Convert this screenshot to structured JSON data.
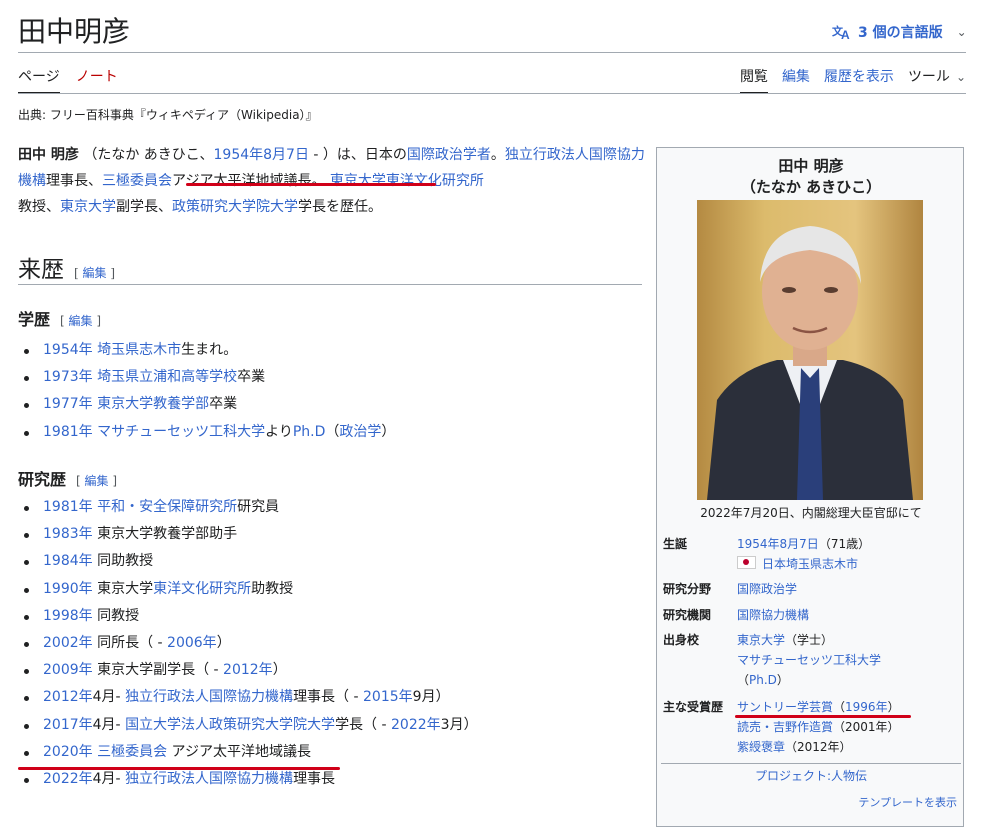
{
  "header": {
    "title": "田中明彦",
    "lang_icon": "translate-icon",
    "lang_label": "3 個の言語版",
    "tabs_left": {
      "page": "ページ",
      "note": "ノート"
    },
    "tabs_right": {
      "read": "閲覧",
      "edit": "編集",
      "history": "履歴を表示",
      "tools": "ツール"
    }
  },
  "source": "出典: フリー百科事典『ウィキペディア（Wikipedia）』",
  "intro": {
    "name": "田中 明彦",
    "reading_open": "（たなか あきひこ、",
    "birth": "1954年8月7日",
    "reading_close": " - ）は、日本の",
    "field": "国際政治学者",
    "t1": "。",
    "jica": "独立行政法人国際協力機構",
    "t2": "理事長、",
    "trilateral": "三極委員会",
    "t3": "アジア太平洋地域議長",
    "t4": "。",
    "ioc": "東京大学東洋文化研究所",
    "t5": "教授、",
    "utokyo": "東京大学",
    "t6": "副学長、",
    "grips": "政策研究大学院大学",
    "t7": "学長を歴任。"
  },
  "sections": {
    "history": "来歴",
    "edit": "編集",
    "education": "学歴",
    "research": "研究歴"
  },
  "education": [
    {
      "year": "1954年",
      "place": "埼玉県志木市",
      "rest": "生まれ。"
    },
    {
      "year": "1973年",
      "place": "埼玉県立浦和高等学校",
      "rest": "卒業"
    },
    {
      "year": "1977年",
      "place": "東京大学教養学部",
      "rest": "卒業"
    },
    {
      "year": "1981年",
      "place": "マサチューセッツ工科大学",
      "rest": "より",
      "deg": "Ph.D",
      "p1": "（",
      "sub": "政治学",
      "p2": "）"
    }
  ],
  "research": {
    "r1_year": "1981年",
    "r1_org": "平和・安全保障研究所",
    "r1_rest": "研究員",
    "r2_year": "1983年",
    "r2_rest": "東京大学教養学部助手",
    "r3_year": "1984年",
    "r3_rest": "同助教授",
    "r4_year": "1990年",
    "r4_pre": "東京大学",
    "r4_org": "東洋文化研究所",
    "r4_rest": "助教授",
    "r5_year": "1998年",
    "r5_rest": "同教授",
    "r6_year": "2002年",
    "r6_rest": "同所長（ - ",
    "r6_end": "2006年",
    "r6_close": "）",
    "r7_year": "2009年",
    "r7_rest": "東京大学副学長（ - ",
    "r7_end": "2012年",
    "r7_close": "）",
    "r8_year": "2012年",
    "r8_month": "4月- ",
    "r8_org": "独立行政法人国際協力機構",
    "r8_rest": "理事長（ - ",
    "r8_end": "2015年",
    "r8_close": "9月）",
    "r9_year": "2017年",
    "r9_month": "4月- ",
    "r9_org": "国立大学法人政策研究大学院大学",
    "r9_rest": "学長（ - ",
    "r9_end": "2022年",
    "r9_close": "3月）",
    "r10_year": "2020年",
    "r10_org": "三極委員会",
    "r10_rest": "アジア太平洋地域議長",
    "r11_year": "2022年",
    "r11_month": "4月- ",
    "r11_org": "独立行政法人国際協力機構",
    "r11_rest": "理事長"
  },
  "infobox": {
    "name": "田中 明彦",
    "reading": "（たなか あきひこ）",
    "caption": "2022年7月20日、内閣総理大臣官邸にて",
    "birth_label": "生誕",
    "birth_date": "1954年8月7日",
    "birth_age": "（71歳）",
    "birth_place": "日本埼玉県志木市",
    "field_label": "研究分野",
    "field_value": "国際政治学",
    "inst_label": "研究機関",
    "inst_value": "国際協力機構",
    "alma_label": "出身校",
    "alma1": "東京大学",
    "alma1_deg": "（学士）",
    "alma2": "マサチューセッツ工科大学",
    "alma2_deg_open": "（",
    "alma2_deg": "Ph.D",
    "alma2_deg_close": "）",
    "award_label": "主な受賞歴",
    "award1": "サントリー学芸賞",
    "award1_open": "（",
    "award1_year": "1996年",
    "award1_close": "）",
    "award2": "読売・吉野作造賞",
    "award2_year": "（2001年）",
    "award3": "紫綬褒章",
    "award3_year": "（2012年）",
    "project": "プロジェクト:人物伝",
    "template": "テンプレートを表示"
  },
  "colors": {
    "link": "#3366cc",
    "text": "#202122",
    "redlink": "#ba0000",
    "annotation": "#d00018"
  }
}
